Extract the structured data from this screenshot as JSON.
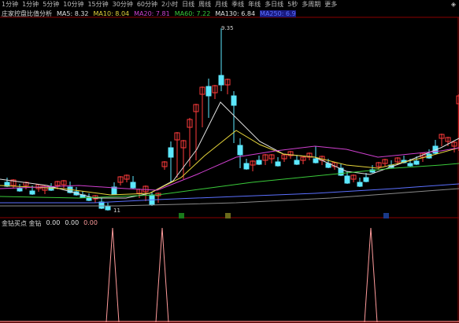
{
  "toolbar": {
    "items": [
      "1分钟",
      "1分钟",
      "5分钟",
      "10分钟",
      "15分钟",
      "30分钟",
      "60分钟",
      "2小时",
      "日线",
      "周线",
      "月线",
      "季线",
      "年线",
      "多日线",
      "5秒",
      "多周期",
      "更多"
    ]
  },
  "legend": {
    "title": "庄家控盘比值分析",
    "ma5": "MA5: 8.32",
    "ma10": "MA10: 8.04",
    "ma20": "MA20: 7.81",
    "ma60": "MA60: 7.22",
    "ma130": "MA130: 6.84",
    "ma250": "MA250: 6.9"
  },
  "price_labels": {
    "high": "9.35",
    "low": "11"
  },
  "sub_legend": {
    "title": "金钻买点 金钻",
    "v1": "0.00",
    "v2": "0.00",
    "v3": "0.00"
  },
  "colors": {
    "up": "#5de8ff",
    "down": "#ff3b3b",
    "ma5": "#e0e0e0",
    "ma10": "#e5d43a",
    "ma20": "#d040d0",
    "ma60": "#3aca3a",
    "ma130": "#5b70ff",
    "ma250": "#8a8a8a",
    "signal": "#ff9b9b"
  }
}
